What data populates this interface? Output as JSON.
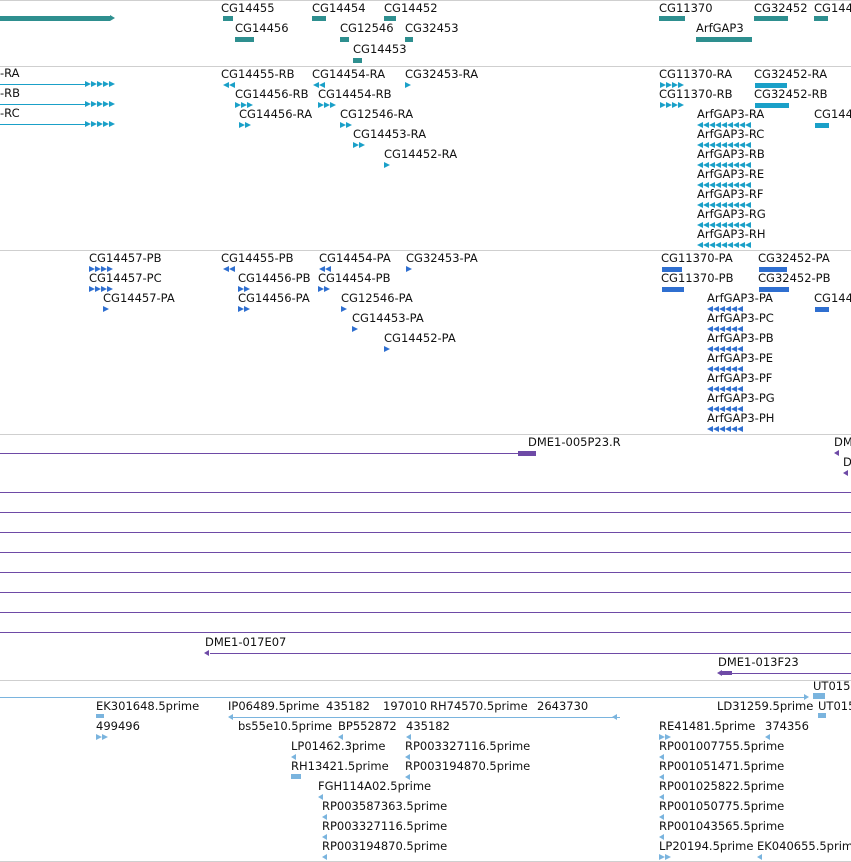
{
  "view": {
    "title": "Genome browser detail tracks",
    "colors": {
      "gene": "#2e8f8f",
      "transcript": "#1aa0c8",
      "protein": "#2f6fd0",
      "clone": "#6e4aa6",
      "est": "#7ab4de",
      "separator": "#cfcfcf"
    }
  },
  "tracks": {
    "genes": {
      "labels": [
        "CG14455",
        "CG14456",
        "CG14454",
        "CG12546",
        "CG14452",
        "CG32453",
        "CG14453",
        "CG11370",
        "ArfGAP3",
        "CG32452",
        "CG144"
      ]
    },
    "transcripts": {
      "labels": [
        "-RA",
        "-RB",
        "-RC",
        "CG14455-RB",
        "CG14456-RB",
        "CG14456-RA",
        "CG14454-RA",
        "CG14454-RB",
        "CG12546-RA",
        "CG14453-RA",
        "CG14452-RA",
        "CG32453-RA",
        "CG11370-RA",
        "CG11370-RB",
        "CG32452-RA",
        "CG32452-RB",
        "CG144",
        "ArfGAP3-RA",
        "ArfGAP3-RC",
        "ArfGAP3-RB",
        "ArfGAP3-RE",
        "ArfGAP3-RF",
        "ArfGAP3-RG",
        "ArfGAP3-RH"
      ]
    },
    "proteins": {
      "labels": [
        "CG14457-PB",
        "CG14457-PC",
        "CG14457-PA",
        "CG14455-PB",
        "CG14456-PB",
        "CG14456-PA",
        "CG14454-PA",
        "CG14454-PB",
        "CG12546-PA",
        "CG14453-PA",
        "CG14452-PA",
        "CG32453-PA",
        "CG11370-PA",
        "CG11370-PB",
        "CG32452-PA",
        "CG32452-PB",
        "CG144",
        "ArfGAP3-PA",
        "ArfGAP3-PC",
        "ArfGAP3-PB",
        "ArfGAP3-PE",
        "ArfGAP3-PF",
        "ArfGAP3-PG",
        "ArfGAP3-PH"
      ]
    },
    "clones": {
      "labels": [
        "DME1-005P23.R",
        "DM",
        "D",
        "DME1-017E07",
        "DME1-013F23"
      ]
    },
    "ests": {
      "labels": [
        "UT015",
        "EK301648.5prime",
        "IP06489.5prime",
        "435182",
        "197010",
        "RH74570.5prime",
        "2643730",
        "LD31259.5prime",
        "UT015",
        "499496",
        "bs55e10.5prime",
        "BP552872",
        "435182",
        "RE41481.5prime",
        "374356",
        "LP01462.3prime",
        "RP003327116.5prime",
        "RP001007755.5prime",
        "RH13421.5prime",
        "RP003194870.5prime",
        "RP001051471.5prime",
        "FGH114A02.5prime",
        "RP001025822.5prime",
        "RP003587363.5prime",
        "RP001050775.5prime",
        "RP003327116.5prime",
        "RP001043565.5prime",
        "RP003194870.5prime",
        "LP20194.5prime",
        "EK040655.5prime"
      ]
    }
  }
}
